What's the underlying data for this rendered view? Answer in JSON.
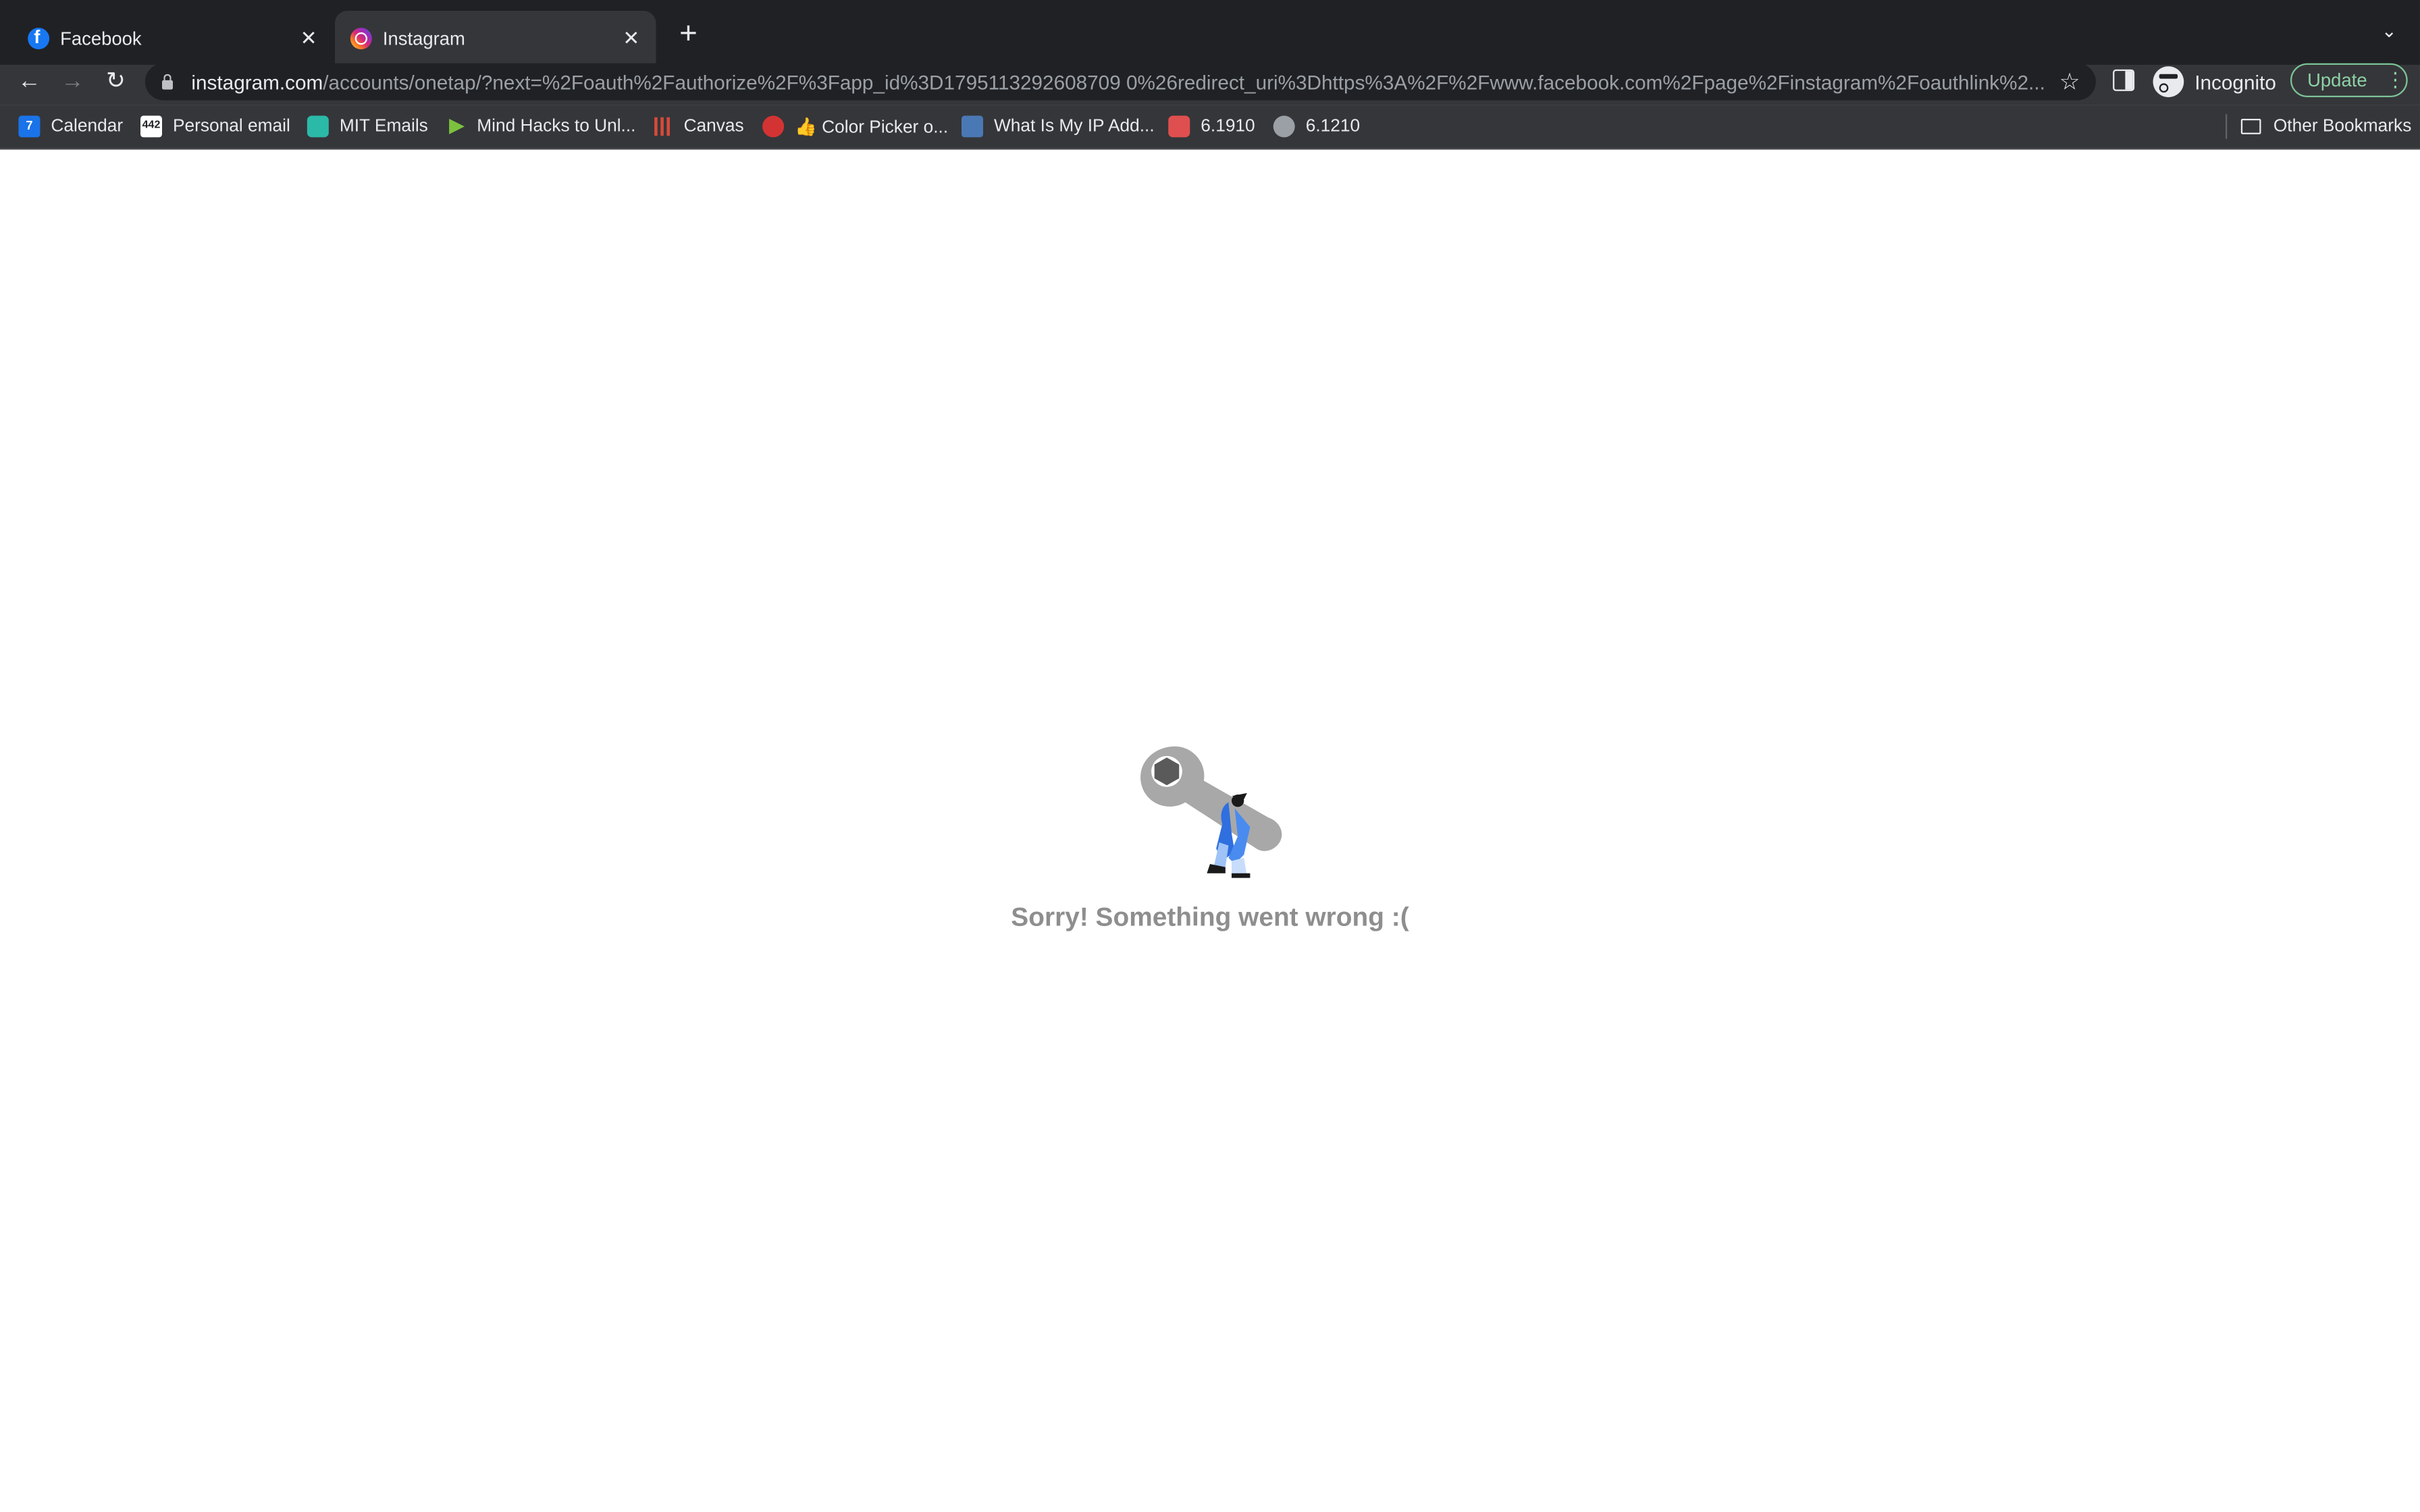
{
  "browser": {
    "tabs": [
      {
        "title": "Facebook",
        "favicon": "facebook-icon",
        "active": false
      },
      {
        "title": "Instagram",
        "favicon": "instagram-icon",
        "active": true
      }
    ],
    "new_tab": "+",
    "tab_list": "⌄",
    "address_bar": {
      "host": "instagram.com",
      "path": "/accounts/onetap/?next=%2Foauth%2Fauthorize%2F%3Fapp_id%3D1795113292608709 0%26redirect_uri%3Dhttps%3A%2F%2Fwww.facebook.com%2Fpage%2Finstagram%2Foauthlink%2..."
    },
    "profile_label": "Incognito",
    "update_label": "Update"
  },
  "bookmarks": [
    {
      "label": "Calendar",
      "icon": "calendar-icon"
    },
    {
      "label": "Personal email",
      "icon": "mail-icon"
    },
    {
      "label": "MIT Emails",
      "icon": "mit-icon"
    },
    {
      "label": "Mind Hacks to Unl...",
      "icon": "play-icon"
    },
    {
      "label": "Canvas",
      "icon": "canvas-icon"
    },
    {
      "label": "👍 Color Picker o...",
      "icon": "color-picker-icon"
    },
    {
      "label": "What Is My IP Add...",
      "icon": "ip-icon"
    },
    {
      "label": "6.1910",
      "icon": "course-icon"
    },
    {
      "label": "6.1210",
      "icon": "globe-icon"
    }
  ],
  "other_bookmarks": "Other Bookmarks",
  "page": {
    "error_message": "Sorry! Something went wrong :("
  },
  "colors": {
    "tab_strip": "#202124",
    "toolbar": "#35363a",
    "error_text": "#8e8e8e",
    "update_accent": "#8ed1a5"
  }
}
